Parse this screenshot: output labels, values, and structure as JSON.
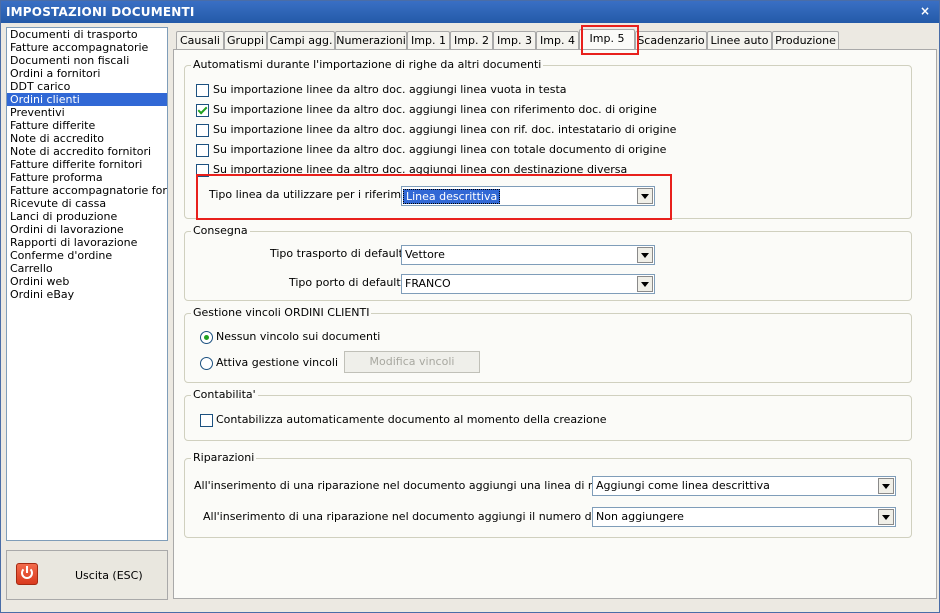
{
  "window": {
    "title": "IMPOSTAZIONI DOCUMENTI",
    "close_symbol": "×"
  },
  "sidebar": {
    "items": [
      {
        "label": "Documenti di trasporto"
      },
      {
        "label": "Fatture accompagnatorie"
      },
      {
        "label": "Documenti non fiscali"
      },
      {
        "label": "Ordini a fornitori"
      },
      {
        "label": "DDT carico"
      },
      {
        "label": "Ordini clienti",
        "selected": true
      },
      {
        "label": "Preventivi"
      },
      {
        "label": "Fatture differite"
      },
      {
        "label": "Note di accredito"
      },
      {
        "label": "Note di accredito fornitori"
      },
      {
        "label": "Fatture differite fornitori"
      },
      {
        "label": "Fatture proforma"
      },
      {
        "label": "Fatture accompagnatorie fornito"
      },
      {
        "label": "Ricevute di cassa"
      },
      {
        "label": "Lanci di produzione"
      },
      {
        "label": "Ordini di lavorazione"
      },
      {
        "label": "Rapporti di lavorazione"
      },
      {
        "label": "Conferme d'ordine"
      },
      {
        "label": "Carrello"
      },
      {
        "label": "Ordini web"
      },
      {
        "label": "Ordini eBay"
      }
    ],
    "exit_label": "Uscita (ESC)"
  },
  "tabs": [
    {
      "label": "Causali"
    },
    {
      "label": "Gruppi"
    },
    {
      "label": "Campi agg."
    },
    {
      "label": "Numerazioni"
    },
    {
      "label": "Imp. 1"
    },
    {
      "label": "Imp. 2"
    },
    {
      "label": "Imp. 3"
    },
    {
      "label": "Imp. 4"
    },
    {
      "label": "Imp. 5",
      "active": true
    },
    {
      "label": "Scadenzario"
    },
    {
      "label": "Linee auto"
    },
    {
      "label": "Produzione"
    }
  ],
  "auto": {
    "title": "Automatismi durante l'importazione di righe da altri documenti",
    "options": [
      {
        "label": "Su importazione linee da altro doc. aggiungi linea vuota in testa",
        "checked": false
      },
      {
        "label": "Su importazione linee da altro doc. aggiungi linea con riferimento doc. di origine",
        "checked": true
      },
      {
        "label": "Su importazione linee da altro doc. aggiungi linea con rif. doc. intestatario di origine",
        "checked": false
      },
      {
        "label": "Su importazione linee da altro doc. aggiungi linea con totale documento di origine",
        "checked": false
      },
      {
        "label": "Su importazione linee da altro doc. aggiungi linea con destinazione diversa",
        "checked": false
      }
    ],
    "tipo_label": "Tipo linea da utilizzare per i riferimenti :",
    "tipo_value": "Linea descrittiva"
  },
  "consegna": {
    "title": "Consegna",
    "trasporto_label": "Tipo trasporto di default :",
    "trasporto_value": "Vettore",
    "porto_label": "Tipo porto di default :",
    "porto_value": "FRANCO"
  },
  "vincoli": {
    "title": "Gestione vincoli ORDINI CLIENTI",
    "opt_none": "Nessun vincolo sui documenti",
    "opt_active": "Attiva gestione vincoli",
    "selected": "none",
    "modify_button": "Modifica vincoli"
  },
  "contabilita": {
    "title": "Contabilita'",
    "option": "Contabilizza automaticamente documento al momento della creazione",
    "checked": false
  },
  "riparazioni": {
    "title": "Riparazioni",
    "rif_label": "All'inserimento di una riparazione nel documento aggiungi una linea di riferimento :",
    "rif_value": "Aggiungi come linea descrittiva",
    "matricola_label": "All'inserimento di una riparazione nel documento aggiungi il numero di matricola :",
    "matricola_value": "Non aggiungere"
  },
  "colors": {
    "title_bar": "#245aa8",
    "selection": "#3168d5",
    "highlight_box": "#e8201c",
    "check": "#21a121"
  }
}
